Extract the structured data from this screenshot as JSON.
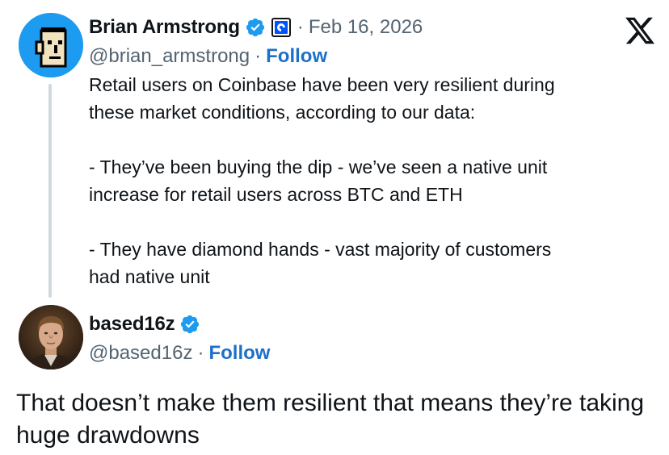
{
  "brand": {
    "logo_icon": "x-logo-icon",
    "accent_color": "#1d9bf0",
    "follow_color": "#1d70c8"
  },
  "original_tweet": {
    "author_name": "Brian Armstrong",
    "verified_icon": "verified-badge-icon",
    "affiliation_icon": "coinbase-logo-icon",
    "date_separator": "·",
    "date": "Feb 16, 2026",
    "handle": "@brian_armstrong",
    "handle_separator": "·",
    "follow_label": "Follow",
    "text": "Retail users on Coinbase have been very resilient during\nthese market conditions, according to our data:\n\n- They’ve been buying the dip - we’ve seen a native unit\nincrease for retail users across BTC and ETH\n\n- They have diamond hands - vast majority of customers\nhad native unit"
  },
  "reply_tweet": {
    "author_name": "based16z",
    "verified_icon": "verified-badge-icon",
    "handle": "@based16z",
    "handle_separator": "·",
    "follow_label": "Follow",
    "text": "That doesn’t make them resilient that means they’re taking huge drawdowns"
  }
}
